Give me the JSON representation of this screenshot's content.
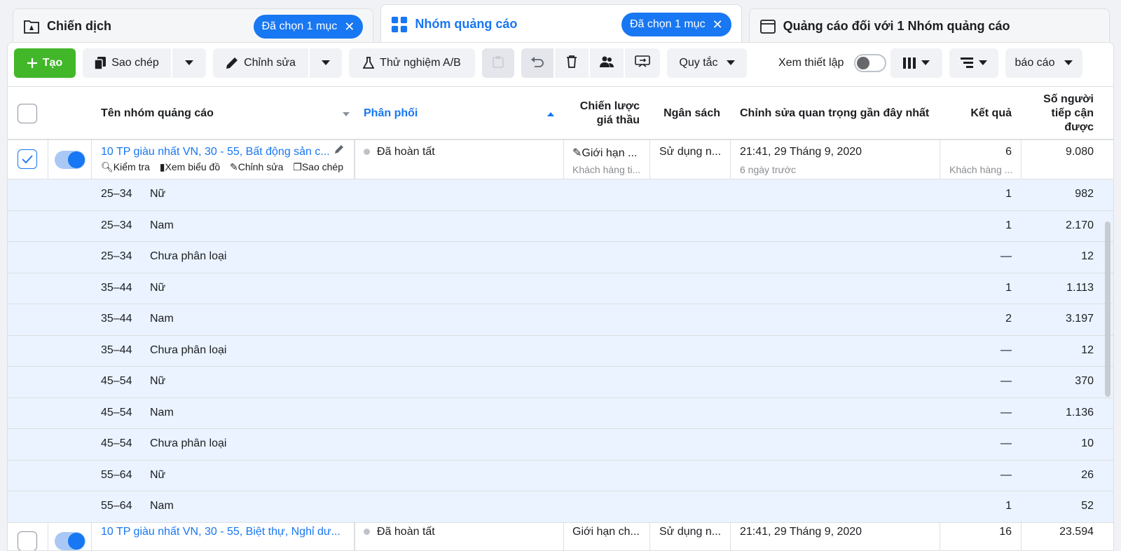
{
  "tabs": [
    {
      "label": "Chiến dịch",
      "chip": "Đã chọn 1 mục",
      "icon": "campaign-folder-icon"
    },
    {
      "label": "Nhóm quảng cáo",
      "chip": "Đã chọn 1 mục",
      "icon": "adset-grid-icon"
    },
    {
      "label": "Quảng cáo đối với 1 Nhóm quảng cáo",
      "icon": "ad-window-icon"
    }
  ],
  "toolbar": {
    "create": "Tạo",
    "duplicate": "Sao chép",
    "edit": "Chỉnh sửa",
    "ab_test": "Thử nghiệm A/B",
    "rules": "Quy tắc",
    "view_setup": "Xem thiết lập",
    "reports": "báo cáo"
  },
  "columns": {
    "name": "Tên nhóm quảng cáo",
    "delivery": "Phân phối",
    "bid_line1": "Chiến lược",
    "bid_line2": "giá thầu",
    "budget": "Ngân sách",
    "last_edit": "Chỉnh sửa quan trọng gần đây nhất",
    "results": "Kết quả",
    "reach_line1": "Số người",
    "reach_line2": "tiếp cận",
    "reach_line3": "được"
  },
  "row1": {
    "name": "10 TP giàu nhất VN, 30 - 55, Bất động sản c...",
    "actions": [
      "Kiểm tra",
      "Xem biểu đồ",
      "Chỉnh sửa",
      "Sao chép"
    ],
    "delivery": "Đã hoàn tất",
    "bid": "Giới hạn ...",
    "bid_sub": "Khách hàng ti...",
    "budget": "Sử dụng n...",
    "last_edit": "21:41, 29 Tháng 9, 2020",
    "last_edit_sub": "6 ngày trước",
    "results": "6",
    "results_sub": "Khách hàng ...",
    "reach": "9.080"
  },
  "breakdown": [
    {
      "age": "25–34",
      "gender": "Nữ",
      "results": "1",
      "reach": "982"
    },
    {
      "age": "25–34",
      "gender": "Nam",
      "results": "1",
      "reach": "2.170"
    },
    {
      "age": "25–34",
      "gender": "Chưa phân loại",
      "results": "—",
      "reach": "12"
    },
    {
      "age": "35–44",
      "gender": "Nữ",
      "results": "1",
      "reach": "1.113"
    },
    {
      "age": "35–44",
      "gender": "Nam",
      "results": "2",
      "reach": "3.197"
    },
    {
      "age": "35–44",
      "gender": "Chưa phân loại",
      "results": "—",
      "reach": "12"
    },
    {
      "age": "45–54",
      "gender": "Nữ",
      "results": "—",
      "reach": "370"
    },
    {
      "age": "45–54",
      "gender": "Nam",
      "results": "—",
      "reach": "1.136"
    },
    {
      "age": "45–54",
      "gender": "Chưa phân loại",
      "results": "—",
      "reach": "10"
    },
    {
      "age": "55–64",
      "gender": "Nữ",
      "results": "—",
      "reach": "26"
    },
    {
      "age": "55–64",
      "gender": "Nam",
      "results": "1",
      "reach": "52"
    }
  ],
  "row2": {
    "name": "10 TP giàu nhất VN, 30 - 55, Biệt thự, Nghỉ dư...",
    "delivery": "Đã hoàn tất",
    "bid": "Giới hạn ch...",
    "budget": "Sử dụng n...",
    "last_edit": "21:41, 29 Tháng 9, 2020",
    "results": "16",
    "reach": "23.594"
  },
  "colors": {
    "accent": "#1877f2",
    "create": "#42b72a",
    "sub_row": "#eaf3ff"
  }
}
